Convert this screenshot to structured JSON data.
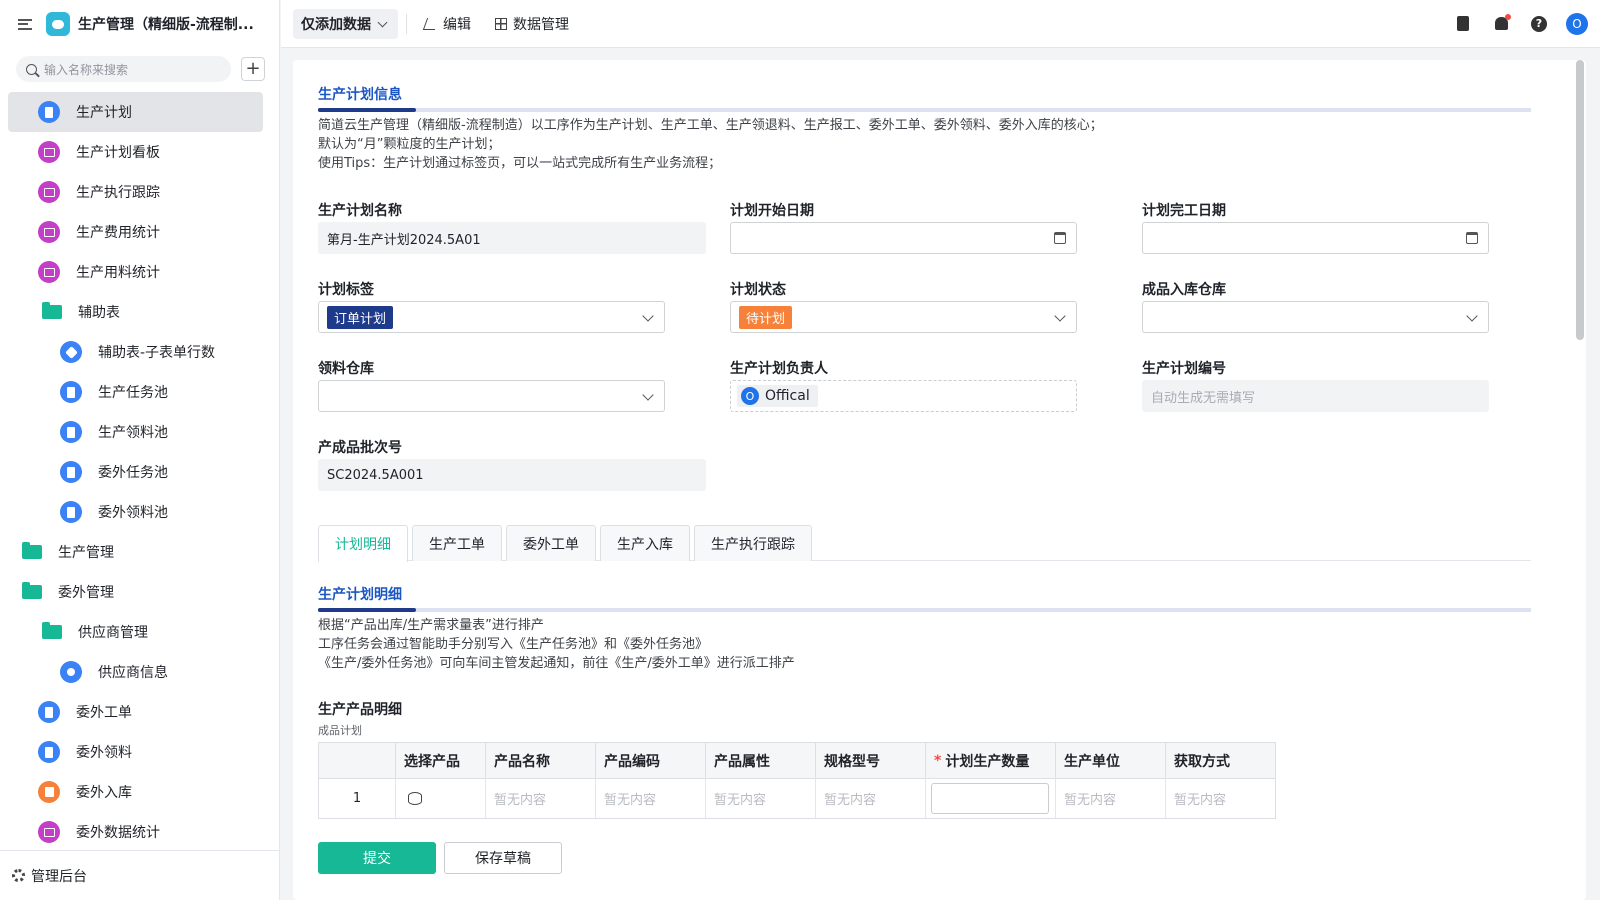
{
  "app": {
    "title": "生产管理（精细版-流程制..."
  },
  "search": {
    "placeholder": "输入名称来搜索"
  },
  "sidebar": {
    "items": [
      {
        "label": "生产计划",
        "icon": "document-icon",
        "active": true
      },
      {
        "label": "生产计划看板",
        "icon": "chart-icon"
      },
      {
        "label": "生产执行跟踪",
        "icon": "chart-icon"
      },
      {
        "label": "生产费用统计",
        "icon": "chart-icon"
      },
      {
        "label": "生产用料统计",
        "icon": "chart-icon"
      },
      {
        "label": "辅助表",
        "icon": "folder-icon"
      },
      {
        "label": "辅助表-子表单行数",
        "icon": "tag-icon"
      },
      {
        "label": "生产任务池",
        "icon": "document-icon"
      },
      {
        "label": "生产领料池",
        "icon": "document-icon"
      },
      {
        "label": "委外任务池",
        "icon": "document-icon"
      },
      {
        "label": "委外领料池",
        "icon": "document-icon"
      },
      {
        "label": "生产管理",
        "icon": "folder-icon"
      },
      {
        "label": "委外管理",
        "icon": "folder-icon"
      },
      {
        "label": "供应商管理",
        "icon": "folder-icon"
      },
      {
        "label": "供应商信息",
        "icon": "user-icon"
      },
      {
        "label": "委外工单",
        "icon": "document-icon"
      },
      {
        "label": "委外领料",
        "icon": "document-icon"
      },
      {
        "label": "委外入库",
        "icon": "inbound-icon"
      },
      {
        "label": "委外数据统计",
        "icon": "chart-icon"
      }
    ],
    "footer": "管理后台"
  },
  "toolbar": {
    "view_select": "仅添加数据",
    "edit": "编辑",
    "data_manage": "数据管理",
    "avatar": "O"
  },
  "section1": {
    "title": "生产计划信息",
    "desc": [
      "简道云生产管理（精细版-流程制造）以工序作为生产计划、生产工单、生产领退料、生产报工、委外工单、委外领料、委外入库的核心；",
      "默认为“月”颗粒度的生产计划；",
      "使用Tips：生产计划通过标签页，可以一站式完成所有生产业务流程；"
    ]
  },
  "form": {
    "plan_name_label": "生产计划名称",
    "plan_name": "第月-生产计划2024.5A01",
    "start_label": "计划开始日期",
    "end_label": "计划完工日期",
    "tag_label": "计划标签",
    "tag_value": "订单计划",
    "tag_color": "#1e3a8a",
    "status_label": "计划状态",
    "status_value": "待计划",
    "status_color": "#f5813a",
    "warehouse_label": "成品入库仓库",
    "pick_label": "领料仓库",
    "owner_label": "生产计划负责人",
    "owner_initial": "O",
    "owner_name": "Offical",
    "code_label": "生产计划编号",
    "code_placeholder": "自动生成无需填写",
    "batch_label": "产成品批次号",
    "batch_value": "SC2024.5A001"
  },
  "tabs": [
    "计划明细",
    "生产工单",
    "委外工单",
    "生产入库",
    "生产执行跟踪"
  ],
  "section2": {
    "title": "生产计划明细",
    "desc": [
      "根据“产品出库/生产需求量表”进行排产",
      "工序任务会通过智能助手分别写入《生产任务池》和《委外任务池》",
      "《生产/委外任务池》可向车间主管发起通知，前往《生产/委外工单》进行派工排产"
    ]
  },
  "table": {
    "title": "生产产品明细",
    "subtitle": "成品计划",
    "headers": [
      "",
      "选择产品",
      "产品名称",
      "产品编码",
      "产品属性",
      "规格型号",
      "计划生产数量",
      "生产单位",
      "获取方式"
    ],
    "row": {
      "index": "1",
      "empty": "暂无内容"
    }
  },
  "actions": {
    "submit": "提交",
    "draft": "保存草稿"
  }
}
